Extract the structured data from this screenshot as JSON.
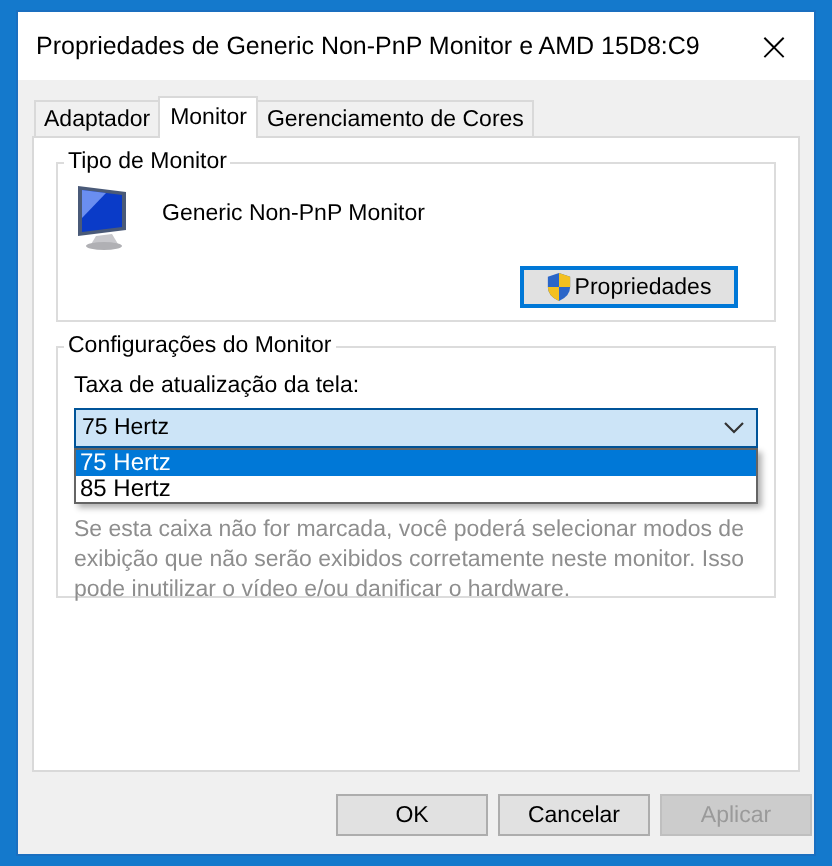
{
  "window": {
    "title": "Propriedades de Generic Non-PnP Monitor e AMD 15D8:C9",
    "close": "×"
  },
  "tabs": [
    {
      "label": "Adaptador",
      "selected": false
    },
    {
      "label": "Monitor",
      "selected": true
    },
    {
      "label": "Gerenciamento de Cores",
      "selected": false
    }
  ],
  "monitor_type": {
    "title": "Tipo de Monitor",
    "device": "Generic Non-PnP Monitor",
    "button": "Propriedades"
  },
  "monitor_settings": {
    "title": "Configurações do Monitor",
    "label": "Taxa de atualização da tela:",
    "dropdown": {
      "value": "75 Hertz",
      "expanded": true,
      "options": [
        {
          "label": "75 Hertz",
          "selected": true
        },
        {
          "label": "85 Hertz",
          "selected": false
        }
      ]
    },
    "note": {
      "text": "Se esta caixa não for marcada, você poderá selecionar modos de exibição que não serão exibidos corretamente neste monitor. Isso pode inutilizar o vídeo e/ou danificar o hardware.",
      "disabled": true
    }
  },
  "buttons": [
    {
      "label": "OK",
      "disabled": false
    },
    {
      "label": "Cancelar",
      "disabled": false
    },
    {
      "label": "Aplicar",
      "disabled": true
    }
  ]
}
